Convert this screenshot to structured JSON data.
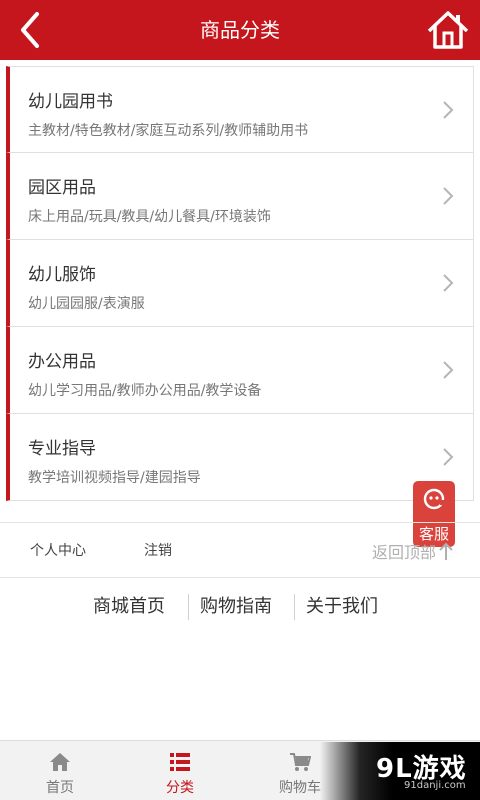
{
  "header": {
    "title": "商品分类",
    "back_icon": "chevron-left-icon",
    "home_icon": "home-icon"
  },
  "categories": [
    {
      "title": "幼儿园用书",
      "subtitle": "主教材/特色教材/家庭互动系列/教师辅助用书"
    },
    {
      "title": "园区用品",
      "subtitle": "床上用品/玩具/教具/幼儿餐具/环境装饰"
    },
    {
      "title": "幼儿服饰",
      "subtitle": "幼儿园园服/表演服"
    },
    {
      "title": "办公用品",
      "subtitle": "幼儿学习用品/教师办公用品/教学设备"
    },
    {
      "title": "专业指导",
      "subtitle": "教学培训视频指导/建园指导"
    }
  ],
  "service": {
    "label": "客服"
  },
  "footer_links": {
    "personal": "个人中心",
    "logout": "注销",
    "back_top": "返回顶部"
  },
  "bottom_nav": [
    "商城首页",
    "购物指南",
    "关于我们"
  ],
  "tabs": [
    {
      "label": "首页",
      "icon": "home-icon"
    },
    {
      "label": "分类",
      "icon": "category-icon"
    },
    {
      "label": "购物车",
      "icon": "cart-icon"
    },
    {
      "label": "",
      "icon": ""
    }
  ],
  "watermark": {
    "main": "9L游戏",
    "url": "91danji.com"
  },
  "colors": {
    "primary": "#c4161c",
    "service": "#d9433b"
  }
}
